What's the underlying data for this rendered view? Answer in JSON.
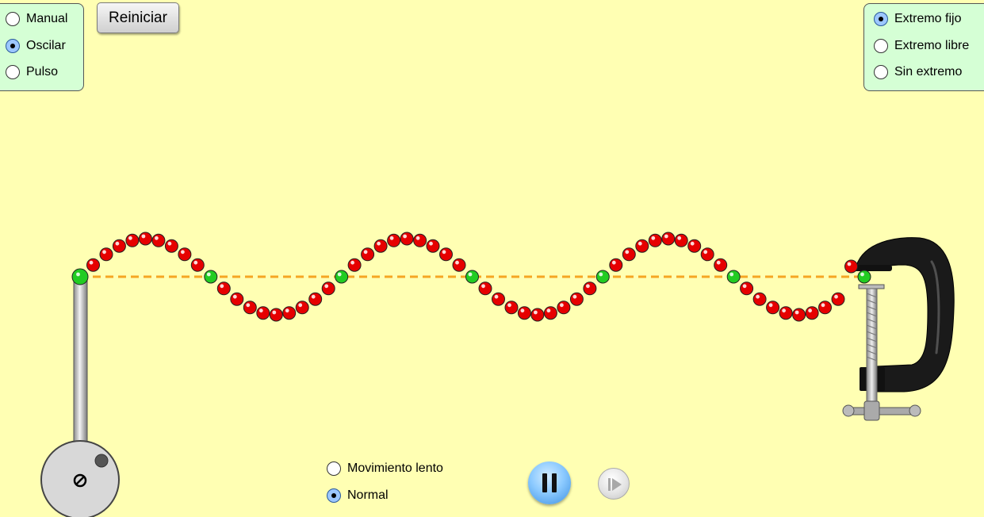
{
  "controls": {
    "mode": {
      "options": [
        "Manual",
        "Oscilar",
        "Pulso"
      ],
      "selected": "Oscilar"
    },
    "reset_label": "Reiniciar",
    "end": {
      "options": [
        "Extremo fijo",
        "Extremo libre",
        "Sin extremo"
      ],
      "selected": "Extremo fijo"
    },
    "speed": {
      "options": [
        "Movimiento lento",
        "Normal"
      ],
      "selected": "Normal"
    },
    "playback": {
      "state": "playing"
    }
  },
  "colors": {
    "background": "#ffffb3",
    "panel": "#d5ffd5",
    "bead": "#e60000",
    "bead_highlight": "#22cc22",
    "equilibrium_line": "#f5a623",
    "selected_radio": "#9cc7ff",
    "pause_button": "#8ccaff"
  },
  "string": {
    "bead_count": 61,
    "highlight_every": 10,
    "wave_cycles": 3,
    "wave_phase_deg": 180
  },
  "icons": {
    "pause": "pause-icon",
    "step": "step-forward-icon",
    "oscillator_pivot": "pivot-icon"
  }
}
